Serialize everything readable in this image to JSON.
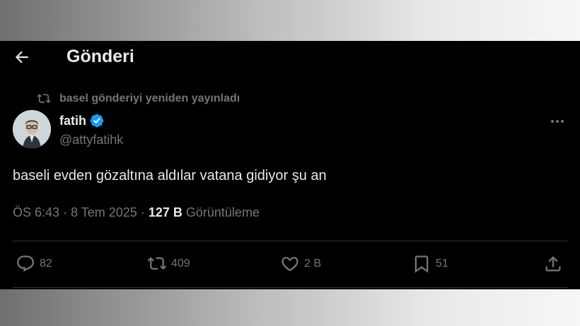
{
  "header": {
    "title": "Gönderi"
  },
  "repost": {
    "text": "basel gönderiyi yeniden yayınladı"
  },
  "author": {
    "name": "fatih",
    "handle": "@attyfatihk"
  },
  "tweet": {
    "text": "baseli evden gözaltına aldılar vatana gidiyor şu an",
    "time": "ÖS 6:43",
    "date": "8 Tem 2025",
    "views_count": "127 B",
    "views_label": "Görüntüleme"
  },
  "actions": {
    "replies": "82",
    "reposts": "409",
    "likes": "2 B",
    "bookmarks": "51"
  },
  "colors": {
    "background": "#000000",
    "text": "#e7e9ea",
    "muted": "#71767b",
    "verified": "#1d9bf0"
  }
}
